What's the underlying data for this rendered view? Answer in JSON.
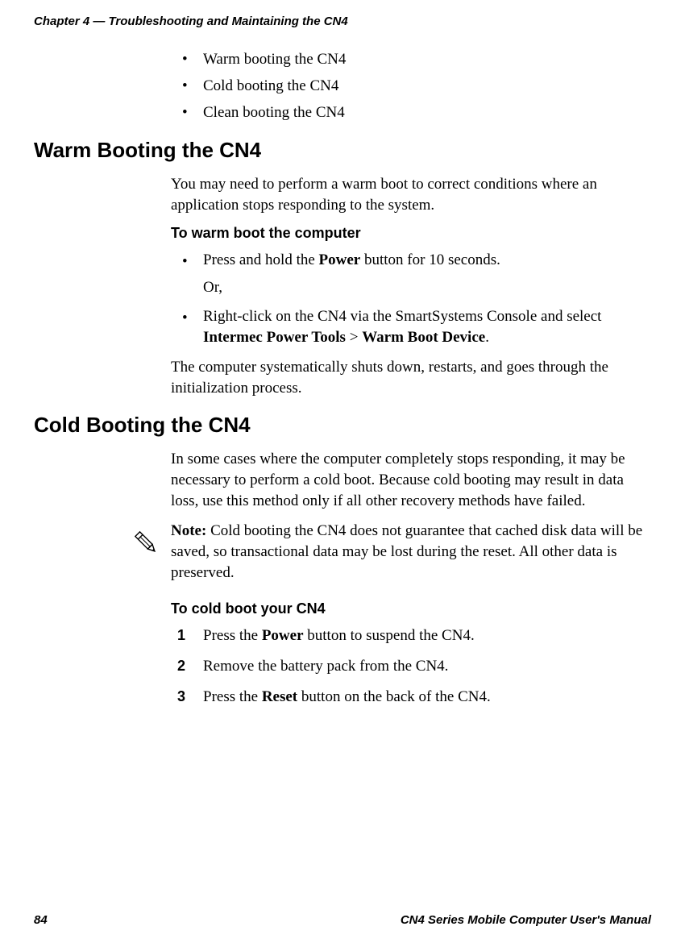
{
  "header": {
    "chapter_title": "Chapter 4 — Troubleshooting and Maintaining the CN4"
  },
  "intro_bullets": [
    "Warm booting the CN4",
    "Cold booting the CN4",
    "Clean booting the CN4"
  ],
  "warm_boot": {
    "heading": "Warm Booting the CN4",
    "para1": "You may need to perform a warm boot to correct conditions where an application stops responding to the system.",
    "subheading": "To warm boot the computer",
    "step1_pre": "Press and hold the ",
    "step1_bold": "Power",
    "step1_post": " button for 10 seconds.",
    "or_text": "Or,",
    "step2_pre": "Right-click on the CN4 via the SmartSystems Console and select ",
    "step2_bold1": "Intermec Power Tools",
    "step2_gt": " > ",
    "step2_bold2": "Warm Boot Device",
    "step2_post": ".",
    "para2": "The computer systematically shuts down, restarts, and goes through the initialization process."
  },
  "cold_boot": {
    "heading": "Cold Booting the CN4",
    "para1": "In some cases where the computer completely stops responding, it may be necessary to perform a cold boot. Because cold booting may result in data loss, use this method only if all other recovery methods have failed.",
    "note_bold": "Note:",
    "note_text": " Cold booting the CN4 does not guarantee that cached disk data will be saved, so transactional data may be lost during the reset. All other data is preserved.",
    "subheading": "To cold boot your CN4",
    "step1_num": "1",
    "step1_pre": "Press the ",
    "step1_bold": "Power",
    "step1_post": " button to suspend the CN4.",
    "step2_num": "2",
    "step2_text": "Remove the battery pack from the CN4.",
    "step3_num": "3",
    "step3_pre": "Press the ",
    "step3_bold": "Reset",
    "step3_post": " button on the back of the CN4."
  },
  "footer": {
    "page_num": "84",
    "manual_title": "CN4 Series Mobile Computer User's Manual"
  }
}
